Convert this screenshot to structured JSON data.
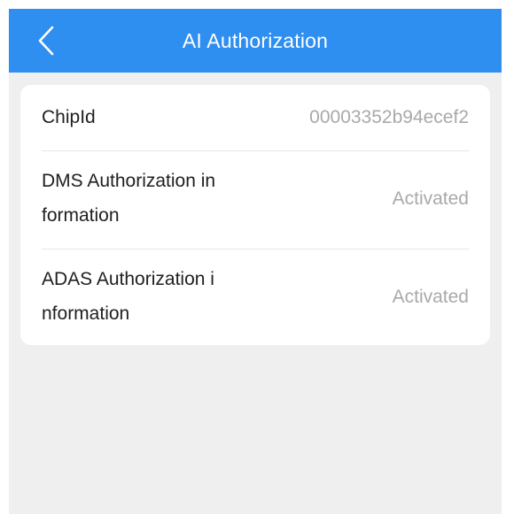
{
  "header": {
    "title": "AI Authorization",
    "back_icon": "chevron-left-icon"
  },
  "colors": {
    "header_bg": "#2e8ff0",
    "page_bg": "#efefef",
    "card_bg": "#ffffff",
    "label_text": "#202020",
    "value_text": "#a9a9a9"
  },
  "rows": [
    {
      "label": "ChipId",
      "value": "00003352b94ecef2"
    },
    {
      "label_line1": "DMS Authorization in",
      "label_line2": "formation",
      "value": "Activated"
    },
    {
      "label_line1": "ADAS Authorization i",
      "label_line2": "nformation",
      "value": "Activated"
    }
  ]
}
